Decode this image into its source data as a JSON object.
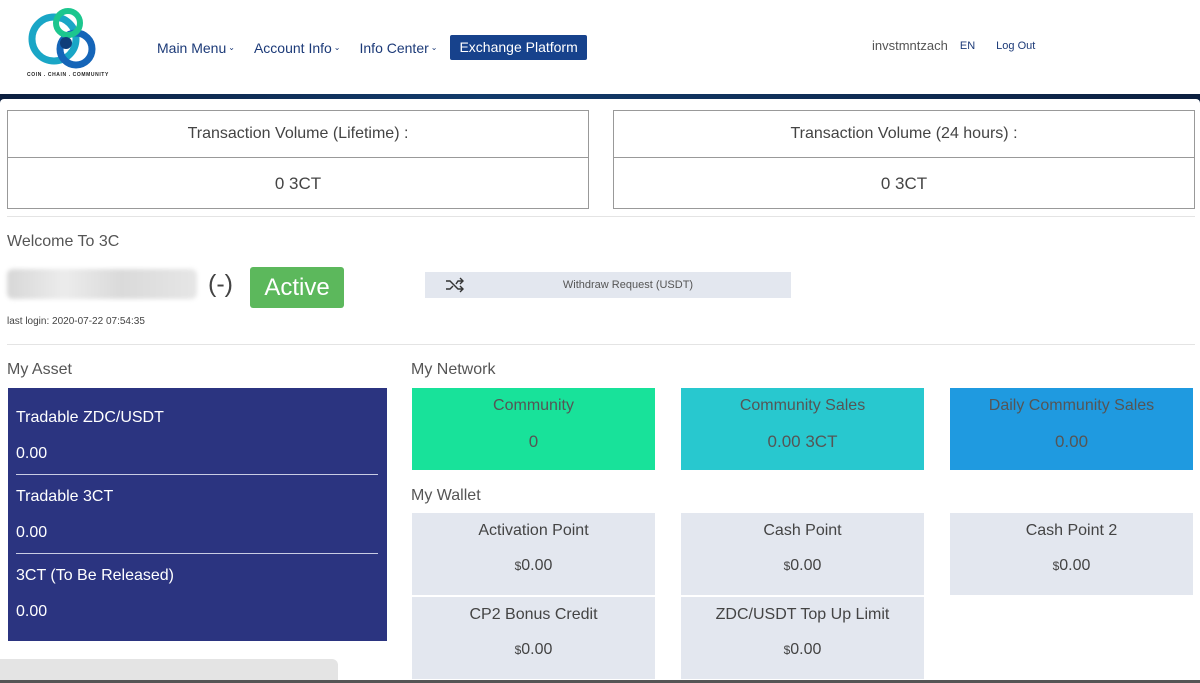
{
  "brand": {
    "tagline": "COIN . CHAIN . COMMUNITY"
  },
  "nav": {
    "items": [
      {
        "label": "Main Menu"
      },
      {
        "label": "Account Info"
      },
      {
        "label": "Info Center"
      }
    ],
    "exchange_label": "Exchange Platform"
  },
  "user": {
    "name": "invstmntzach",
    "language": "EN",
    "logout": "Log Out"
  },
  "volume": {
    "lifetime_label": "Transaction Volume (Lifetime) :",
    "lifetime_value": "0 3CT",
    "day_label": "Transaction Volume (24 hours) :",
    "day_value": "0 3CT"
  },
  "welcome": {
    "title": "Welcome To 3C",
    "rank": "(-)",
    "status": "Active",
    "last_login": "last login: 2020-07-22 07:54:35",
    "withdraw_label": "Withdraw Request (USDT)"
  },
  "asset": {
    "title": "My Asset",
    "items": [
      {
        "label": "Tradable ZDC/USDT",
        "value": "0.00"
      },
      {
        "label": "Tradable 3CT",
        "value": "0.00"
      },
      {
        "label": "3CT (To Be Released)",
        "value": "0.00"
      }
    ]
  },
  "network": {
    "title": "My Network",
    "tiles": [
      {
        "label": "Community",
        "value": "0",
        "color": "#18e29a"
      },
      {
        "label": "Community Sales",
        "value": "0.00 3CT",
        "color": "#28c8cf"
      },
      {
        "label": "Daily Community Sales",
        "value": "0.00",
        "color": "#1f9ae0"
      }
    ]
  },
  "wallet": {
    "title": "My Wallet",
    "currency_symbol": "$",
    "tiles": [
      {
        "label": "Activation Point",
        "value": "0.00"
      },
      {
        "label": "Cash Point",
        "value": "0.00"
      },
      {
        "label": "Cash Point 2",
        "value": "0.00"
      },
      {
        "label": "CP2 Bonus Credit",
        "value": "0.00"
      },
      {
        "label": "ZDC/USDT Top Up Limit",
        "value": "0.00"
      }
    ]
  },
  "colors": {
    "nav_button": "#17428c",
    "asset_panel": "#2b3480",
    "active_badge": "#5cb85c",
    "wallet_tile": "#e3e7ef"
  }
}
